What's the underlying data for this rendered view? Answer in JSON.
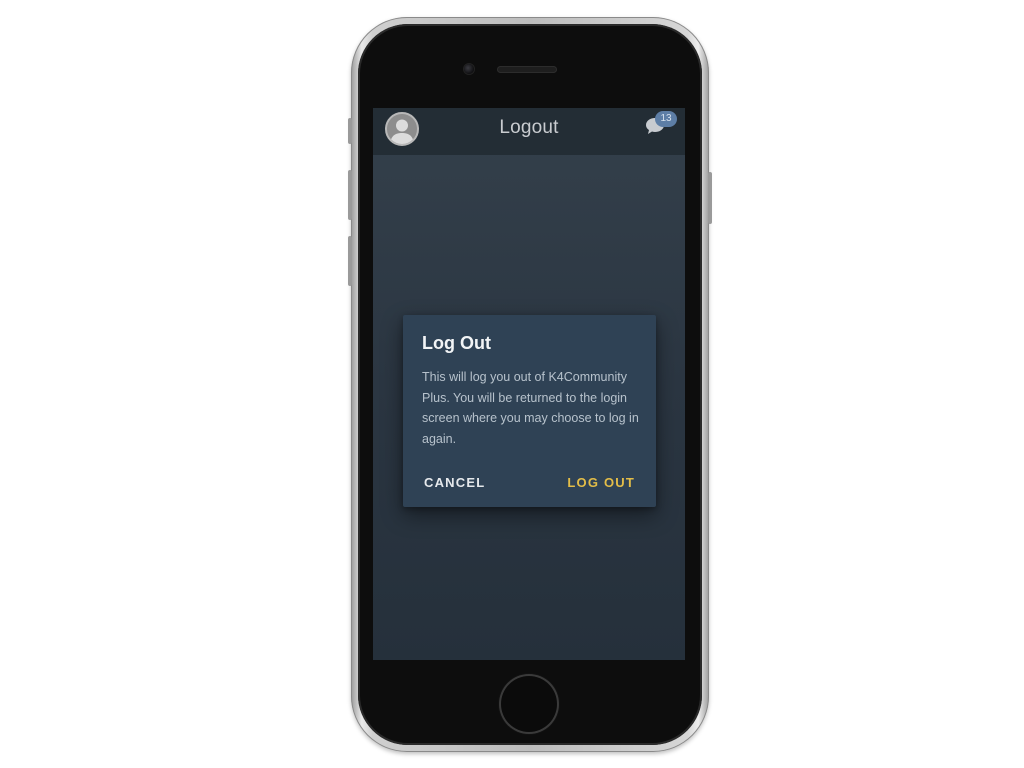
{
  "header": {
    "title": "Logout",
    "chat_badge_count": "13"
  },
  "dialog": {
    "title": "Log Out",
    "message": "This will log you out of K4Community Plus. You will be returned to the login screen where you may choose to log in again.",
    "cancel_label": "CANCEL",
    "confirm_label": "LOG OUT"
  },
  "colors": {
    "header_bg": "#232d35",
    "screen_bg": "#2b3642",
    "dialog_bg": "#2f4255",
    "confirm_accent": "#e3bd48",
    "badge_bg": "#5d7ea6"
  },
  "icons": {
    "avatar": "user-avatar-icon",
    "chat": "chat-bubbles-icon"
  }
}
